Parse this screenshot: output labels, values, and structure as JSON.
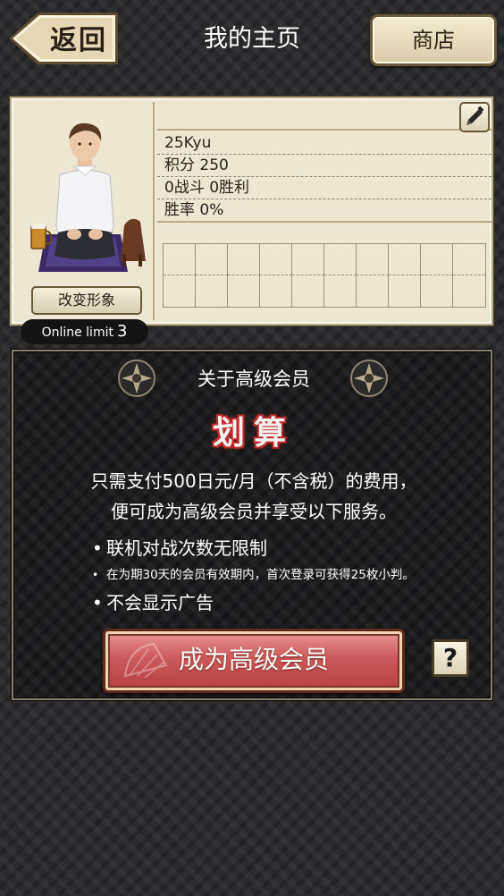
{
  "header": {
    "back_label": "返回",
    "title": "我的主页",
    "shop_label": "商店"
  },
  "profile": {
    "name": "",
    "rank": "25Kyu",
    "points": "积分 250",
    "record": "0战斗 0胜利",
    "win_rate": "胜率 0%",
    "change_look_label": "改变形象",
    "edit_icon": "pencil-icon"
  },
  "online": {
    "label": "Online limit",
    "value": "3"
  },
  "premium": {
    "title": "关于高级会员",
    "deal_label": "划算",
    "desc_line1": "只需支付500日元/月（不含税）的费用，",
    "desc_line2": "便可成为高级会员并享受以下服务。",
    "benefits": [
      "联机对战次数无限制",
      "在为期30天的会员有效期内，首次登录可获得25枚小判。",
      "不会显示广告"
    ],
    "join_label": "成为高级会员",
    "help_label": "?"
  },
  "colors": {
    "background": "#2b2b2d",
    "card": "#ece6d3",
    "button_red": "#cd5a5a",
    "deal_outline": "#c02a2a"
  }
}
